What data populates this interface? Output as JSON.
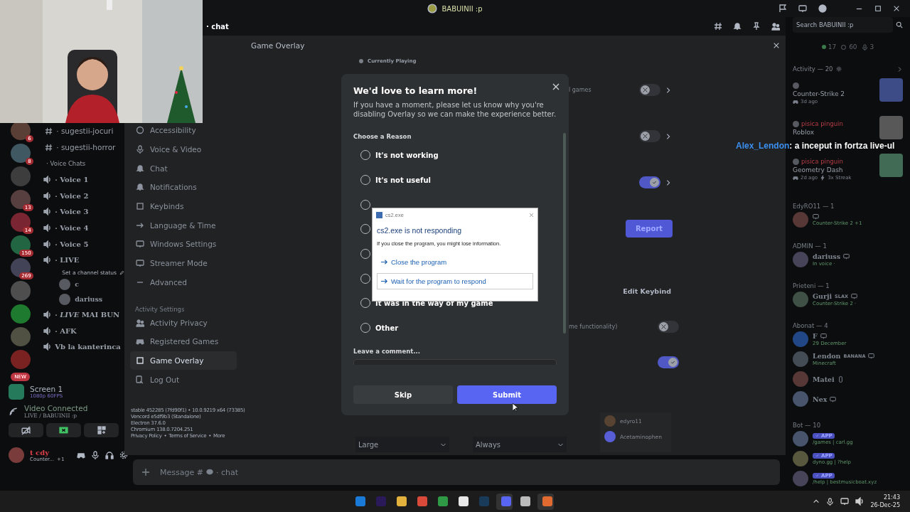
{
  "titlebar": {
    "title": "BABUINII :p"
  },
  "stream_chat": {
    "user": "Alex_Lendon",
    "message": ": a inceput in fortza live-ul"
  },
  "servers": [
    {
      "kind": "server",
      "badge": "6"
    },
    {
      "kind": "server",
      "badge": "8"
    },
    {
      "kind": "server"
    },
    {
      "kind": "server",
      "badge": "13"
    },
    {
      "kind": "server",
      "badge": "14"
    },
    {
      "kind": "server",
      "badge": "150"
    },
    {
      "kind": "server",
      "badge": "269"
    },
    {
      "kind": "server"
    },
    {
      "kind": "server"
    },
    {
      "kind": "server"
    },
    {
      "kind": "server"
    },
    {
      "kind": "new",
      "badge": "NEW"
    }
  ],
  "channels": [
    {
      "kind": "text",
      "name": "· sugestii-jocuri"
    },
    {
      "kind": "text",
      "name": "· sugestii-horror"
    },
    {
      "kind": "category",
      "name": "· Voice Chats"
    },
    {
      "kind": "voice",
      "name": "· Voice 1"
    },
    {
      "kind": "voice",
      "name": "· Voice 2"
    },
    {
      "kind": "voice",
      "name": "· Voice 3"
    },
    {
      "kind": "voice",
      "name": "· Voice 4"
    },
    {
      "kind": "voice",
      "name": "· Voice 5"
    },
    {
      "kind": "voice",
      "name": "· LIVE",
      "status": "Set a channel status",
      "members": [
        {
          "name": "c"
        },
        {
          "name": "dariuss"
        }
      ]
    },
    {
      "kind": "voice",
      "name": "· *LIVE* MAI BUN"
    },
    {
      "kind": "voice",
      "name": "· AFK"
    },
    {
      "kind": "voice",
      "name": "Vb la kanterinca"
    }
  ],
  "voice_panel": {
    "stream": "Screen 1",
    "quality": "1080p 60FPS",
    "status": "Video Connected",
    "channel": "LIVE / BABUINII :p"
  },
  "user_panel": {
    "name": "t cdy",
    "activity": "Counter...",
    "extra": "+1"
  },
  "header": {
    "channel": "· chat"
  },
  "settings_nav": [
    {
      "kind": "item",
      "label": "Accessibility",
      "selected": false
    },
    {
      "kind": "item",
      "label": "Voice & Video",
      "selected": false
    },
    {
      "kind": "item",
      "label": "Chat",
      "selected": false
    },
    {
      "kind": "item",
      "label": "Notifications",
      "selected": false
    },
    {
      "kind": "item",
      "label": "Keybinds",
      "selected": false
    },
    {
      "kind": "item",
      "label": "Language & Time",
      "selected": false
    },
    {
      "kind": "item",
      "label": "Windows Settings",
      "selected": false
    },
    {
      "kind": "item",
      "label": "Streamer Mode",
      "selected": false
    },
    {
      "kind": "item",
      "label": "Advanced",
      "selected": false
    },
    {
      "kind": "header",
      "label": "Activity Settings"
    },
    {
      "kind": "item",
      "label": "Activity Privacy",
      "selected": false
    },
    {
      "kind": "item",
      "label": "Registered Games",
      "selected": false
    },
    {
      "kind": "item",
      "label": "Game Overlay",
      "selected": true
    },
    {
      "kind": "item",
      "label": "Log Out",
      "selected": false
    }
  ],
  "version_info": {
    "lines": [
      "stable 452285 (7fd90f1) • 10.0.9219 x64 (73385)",
      "Vencord e5df9b3 (Standalone)",
      "Electron 37.6.0",
      "Chromium 138.0.7204.251"
    ],
    "links": [
      "Privacy Policy",
      "Terms of Service",
      "More"
    ],
    "separator": "•"
  },
  "overlay_settings": {
    "title": "Game Overlay",
    "section": "Currently Playing",
    "rows": [
      {
        "kind": "toggle-link",
        "text": "l games",
        "on": false
      },
      {
        "kind": "toggle-link",
        "on": false
      },
      {
        "kind": "toggle-link",
        "on": true
      },
      {
        "kind": "button",
        "label": "Report"
      },
      {
        "kind": "keybind",
        "label": "Edit Keybind"
      },
      {
        "kind": "toggle",
        "text": "me functionality)",
        "on": false
      },
      {
        "kind": "toggle",
        "on": true
      }
    ],
    "dropdowns": [
      "Large",
      "Always"
    ],
    "users": [
      "edyro11",
      "Acetaminophen"
    ]
  },
  "message_bar": {
    "prefix": "Message #",
    "channel": "· chat"
  },
  "members": {
    "search": {
      "placeholder": "Search BABUINII :p"
    },
    "counts": [
      {
        "kind": "online",
        "value": "17"
      },
      {
        "kind": "offline",
        "value": "60"
      },
      {
        "kind": "voice",
        "value": "3"
      }
    ],
    "activity": {
      "title": "Activity — 20",
      "cards": [
        {
          "game": "Counter-Strike 2",
          "detail": "3d ago"
        },
        {
          "user": "pisica pinguin",
          "game": "Roblox"
        },
        {
          "user": "pisica pinguin",
          "game": "Geometry Dash",
          "detail": "2d ago",
          "streak": "3x Streak"
        }
      ]
    },
    "groups": [
      {
        "title": "EdyRO11 — 1",
        "members": [
          {
            "activity": "Counter-Strike 2 +1"
          }
        ]
      },
      {
        "title": "ADMIN — 1",
        "members": [
          {
            "name": "dariuss",
            "activity": "In voice ·"
          }
        ]
      },
      {
        "title": "Prieteni — 1",
        "members": [
          {
            "name": "Gurji",
            "tag": "SLAX",
            "activity": "Counter-Strike 2 ·"
          }
        ]
      },
      {
        "title": "Abonat — 4",
        "members": [
          {
            "name": "F",
            "activity": "29 December"
          },
          {
            "name": "Lendon",
            "tag": "BANANA",
            "activity": "Minecraft"
          },
          {
            "name": "Matei"
          },
          {
            "name": "Nex"
          }
        ]
      },
      {
        "title": "Bot — 10",
        "members": [
          {
            "tag": "APP",
            "activity": "/games | carl.gg"
          },
          {
            "tag": "APP",
            "activity": "dyno.gg | ?help"
          },
          {
            "tag": "APP",
            "activity": "/help | bestmusicboat.xyz"
          }
        ]
      }
    ]
  },
  "modal": {
    "title": "We'd love to learn more!",
    "text": "If you have a moment, please let us know why you're disabling Overlay so we can make the experience better.",
    "label": "Choose a Reason",
    "options": [
      {
        "label": "It's not working",
        "selected": false
      },
      {
        "label": "It's not useful",
        "selected": false
      },
      {
        "selected": false
      },
      {
        "selected": false
      },
      {
        "selected": false
      },
      {
        "selected": false
      },
      {
        "label": "It was in the way of my game",
        "selected": false
      },
      {
        "label": "Other",
        "selected": false
      }
    ],
    "comment_label": "Leave a comment...",
    "buttons": [
      {
        "label": "Skip",
        "kind": "secondary"
      },
      {
        "label": "Submit",
        "kind": "primary"
      }
    ]
  },
  "dialog": {
    "title": "cs2.exe",
    "heading": "cs2.exe is not responding",
    "text": "If you close the program, you might lose information.",
    "actions": [
      {
        "label": "Close the program",
        "selected": false
      },
      {
        "label": "Wait for the program to respond",
        "selected": true
      }
    ]
  },
  "taskbar": {
    "time": "21:43",
    "date": "26-Dec-25"
  }
}
